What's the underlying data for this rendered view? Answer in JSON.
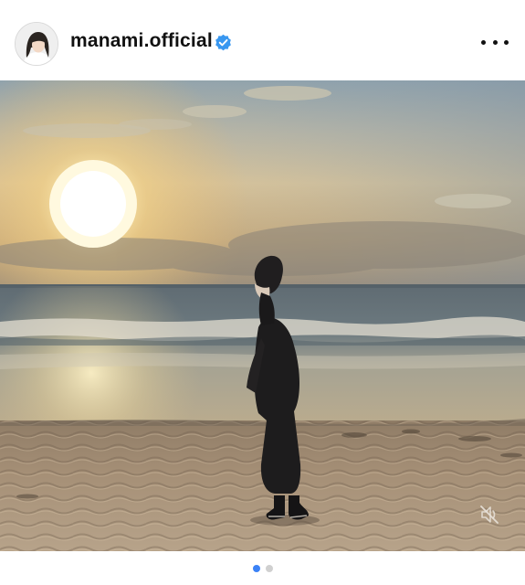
{
  "post": {
    "username": "manami.official",
    "verified": true,
    "more_icon": "more-horizontal-icon",
    "verified_icon": "verified-badge-icon",
    "mute_icon": "speaker-muted-icon",
    "carousel": {
      "total": 2,
      "current": 1
    },
    "colors": {
      "verified_blue": "#3897f0",
      "active_dot": "#3b82f6",
      "inactive_dot": "#d0d0d0"
    }
  }
}
